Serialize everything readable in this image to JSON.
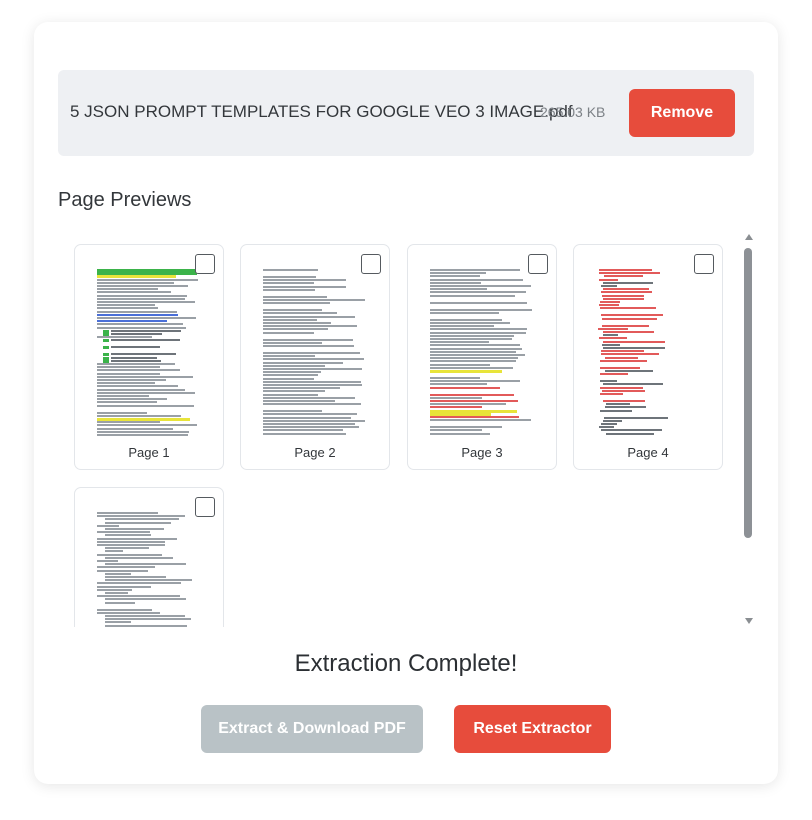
{
  "file": {
    "name": "5 JSON PROMPT TEMPLATES FOR GOOGLE VEO 3 IMAGE.pdf",
    "size": "265.03 KB",
    "remove_label": "Remove"
  },
  "previews": {
    "title": "Page Previews",
    "pages": [
      {
        "label": "Page 1",
        "selected": false
      },
      {
        "label": "Page 2",
        "selected": false
      },
      {
        "label": "Page 3",
        "selected": false
      },
      {
        "label": "Page 4",
        "selected": false
      },
      {
        "label": "",
        "selected": false
      }
    ]
  },
  "status": {
    "message": "Extraction Complete!"
  },
  "actions": {
    "extract_label": "Extract & Download PDF",
    "reset_label": "Reset Extractor"
  },
  "colors": {
    "accent": "#e74c3c",
    "disabled": "#b9c2c6",
    "file_bar_bg": "#eef0f3"
  }
}
